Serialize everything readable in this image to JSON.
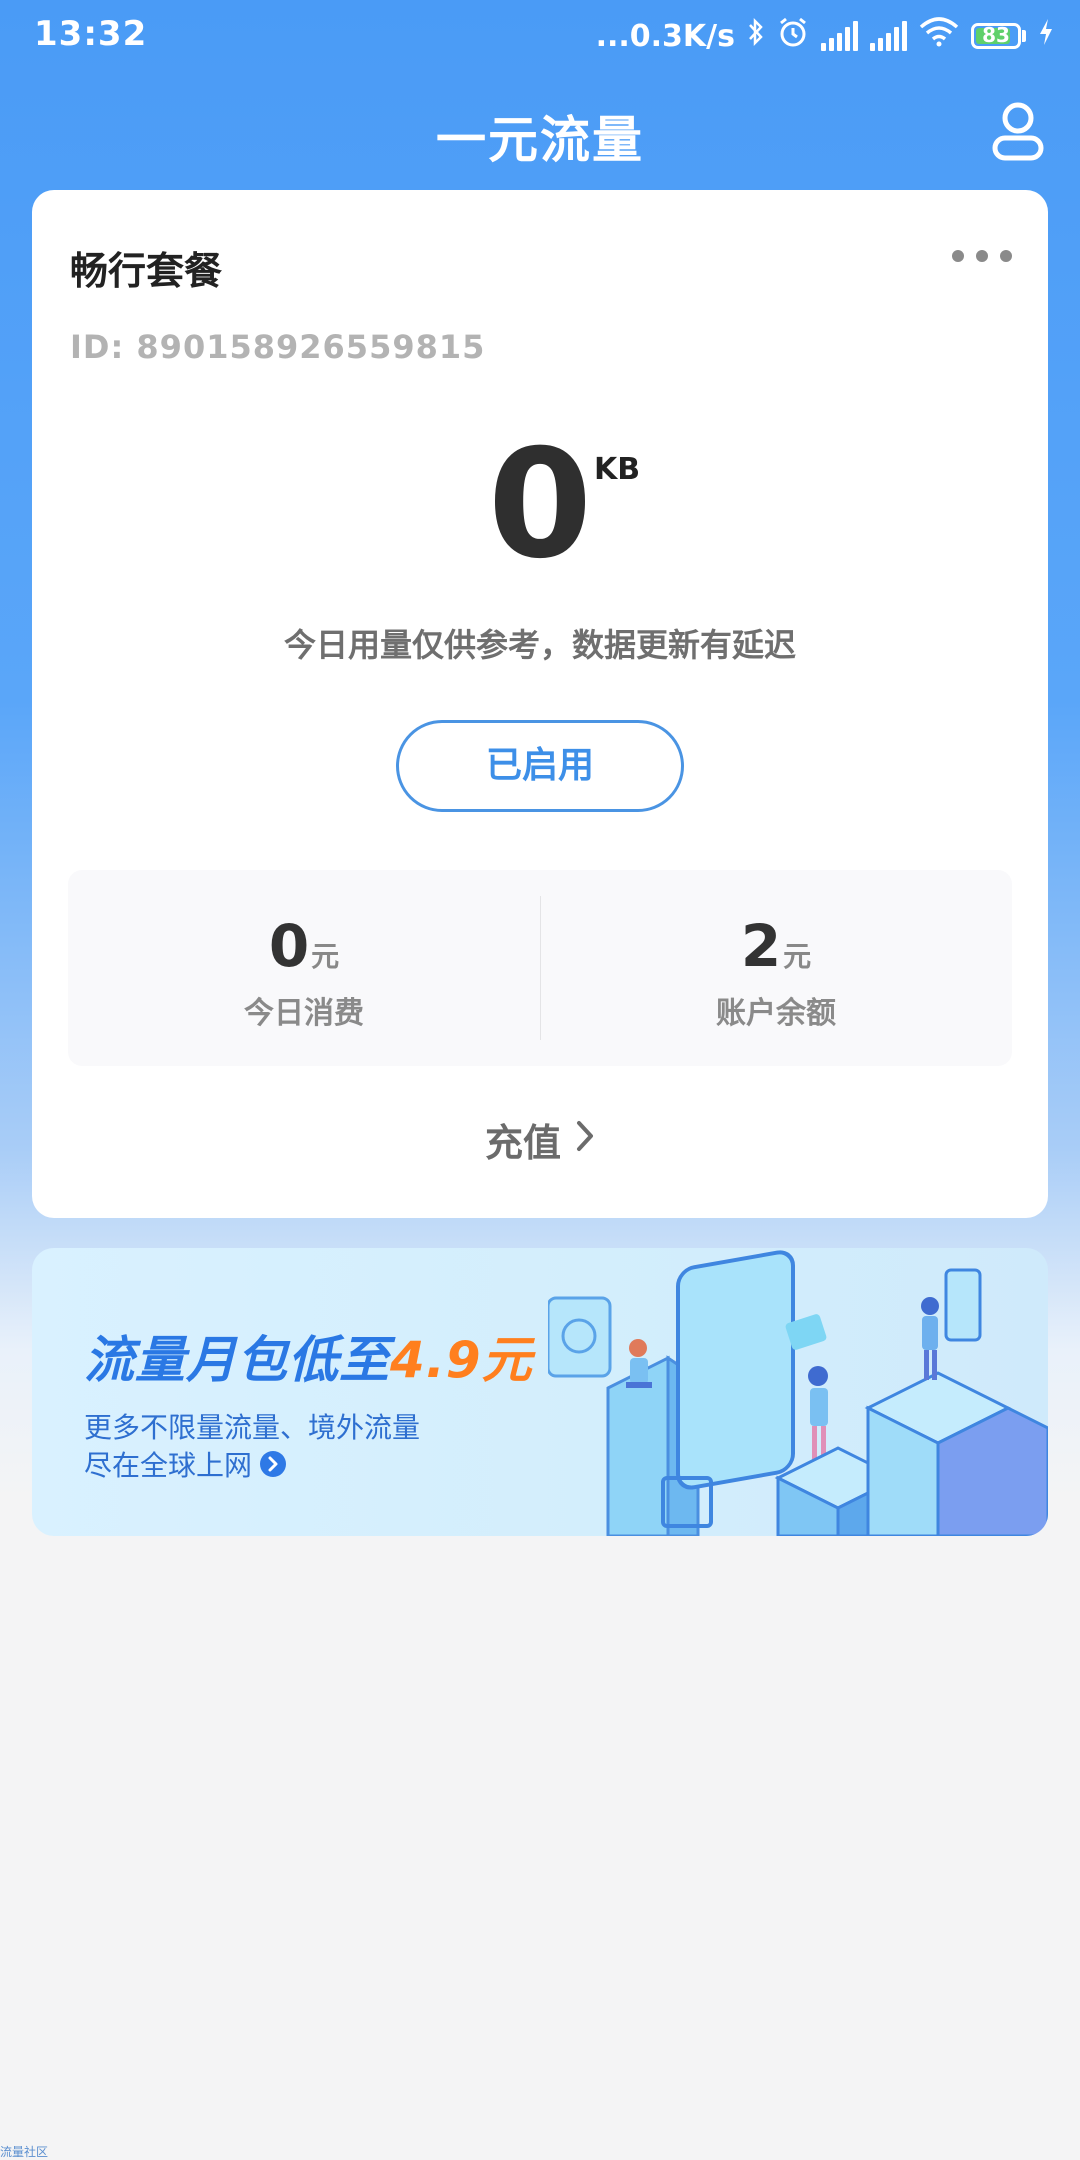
{
  "status_bar": {
    "time": "13:32",
    "net_speed": "...0.3K/s",
    "battery": "83",
    "icons": [
      "bluetooth-icon",
      "alarm-icon",
      "signal-icon",
      "hd-signal-icon",
      "wifi-icon",
      "battery-icon",
      "charging-icon"
    ]
  },
  "header": {
    "title": "一元流量",
    "user_icon": "user-icon"
  },
  "card": {
    "plan_name": "畅行套餐",
    "more_icon": "more-dots-icon",
    "id_text": "ID: 890158926559815",
    "usage_value": "0",
    "usage_unit": "KB",
    "usage_note": "今日用量仅供参考，数据更新有延迟",
    "status_button": "已启用",
    "stats": [
      {
        "value": "0",
        "unit": "元",
        "label": "今日消费"
      },
      {
        "value": "2",
        "unit": "元",
        "label": "账户余额"
      }
    ],
    "recharge_label": "充值"
  },
  "banner": {
    "title_main": "流量月包低至",
    "title_highlight": "4.9元",
    "subtitle_line1": "更多不限量流量、境外流量",
    "subtitle_line2": "尽在全球上网"
  },
  "watermark": "流量社区",
  "colors": {
    "brand": "#4a9bf6",
    "accent_button": "#3d8fe8",
    "highlight": "#ff7f1e"
  }
}
